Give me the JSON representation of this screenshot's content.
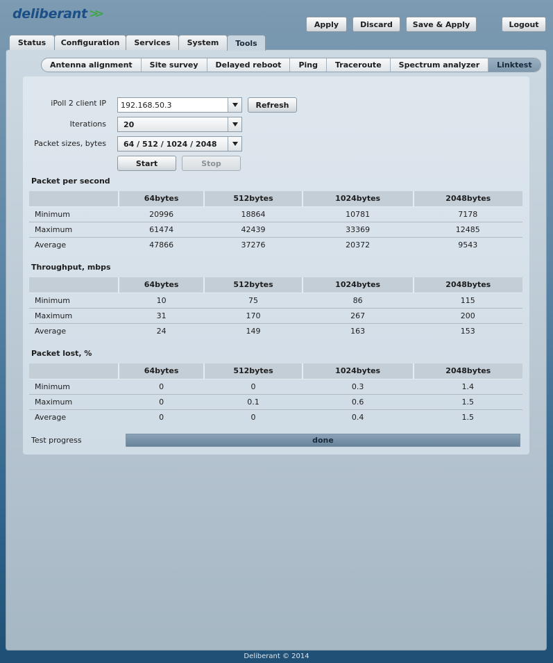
{
  "brand": {
    "logo_text": "deliberant",
    "logo_icon": "chevron-arrows-icon",
    "accent": "#3fa64a",
    "brand_color": "#1b4f86"
  },
  "header_buttons": {
    "apply": "Apply",
    "discard": "Discard",
    "save_apply": "Save & Apply",
    "logout": "Logout"
  },
  "main_tabs": [
    {
      "label": "Status",
      "active": false
    },
    {
      "label": "Configuration",
      "active": false
    },
    {
      "label": "Services",
      "active": false
    },
    {
      "label": "System",
      "active": false
    },
    {
      "label": "Tools",
      "active": true
    }
  ],
  "sub_tabs": [
    {
      "label": "Antenna alignment",
      "active": false
    },
    {
      "label": "Site survey",
      "active": false
    },
    {
      "label": "Delayed reboot",
      "active": false
    },
    {
      "label": "Ping",
      "active": false
    },
    {
      "label": "Traceroute",
      "active": false
    },
    {
      "label": "Spectrum analyzer",
      "active": false
    },
    {
      "label": "Linktest",
      "active": true
    }
  ],
  "form": {
    "client_ip_label": "iPoll 2 client IP",
    "client_ip_value": "192.168.50.3",
    "refresh_label": "Refresh",
    "iterations_label": "Iterations",
    "iterations_value": "20",
    "packet_sizes_label": "Packet sizes, bytes",
    "packet_sizes_value": "64 / 512 / 1024 / 2048",
    "start_label": "Start",
    "stop_label": "Stop"
  },
  "tables": [
    {
      "title": "Packet per second",
      "columns": [
        "",
        "64bytes",
        "512bytes",
        "1024bytes",
        "2048bytes"
      ],
      "rows": [
        [
          "Minimum",
          "20996",
          "18864",
          "10781",
          "7178"
        ],
        [
          "Maximum",
          "61474",
          "42439",
          "33369",
          "12485"
        ],
        [
          "Average",
          "47866",
          "37276",
          "20372",
          "9543"
        ]
      ]
    },
    {
      "title": "Throughput, mbps",
      "columns": [
        "",
        "64bytes",
        "512bytes",
        "1024bytes",
        "2048bytes"
      ],
      "rows": [
        [
          "Minimum",
          "10",
          "75",
          "86",
          "115"
        ],
        [
          "Maximum",
          "31",
          "170",
          "267",
          "200"
        ],
        [
          "Average",
          "24",
          "149",
          "163",
          "153"
        ]
      ]
    },
    {
      "title": "Packet lost, %",
      "columns": [
        "",
        "64bytes",
        "512bytes",
        "1024bytes",
        "2048bytes"
      ],
      "rows": [
        [
          "Minimum",
          "0",
          "0",
          "0.3",
          "1.4"
        ],
        [
          "Maximum",
          "0",
          "0.1",
          "0.6",
          "1.5"
        ],
        [
          "Average",
          "0",
          "0",
          "0.4",
          "1.5"
        ]
      ]
    }
  ],
  "progress": {
    "label": "Test progress",
    "status": "done",
    "percent": 100
  },
  "footer": {
    "text": "Deliberant © 2014"
  }
}
